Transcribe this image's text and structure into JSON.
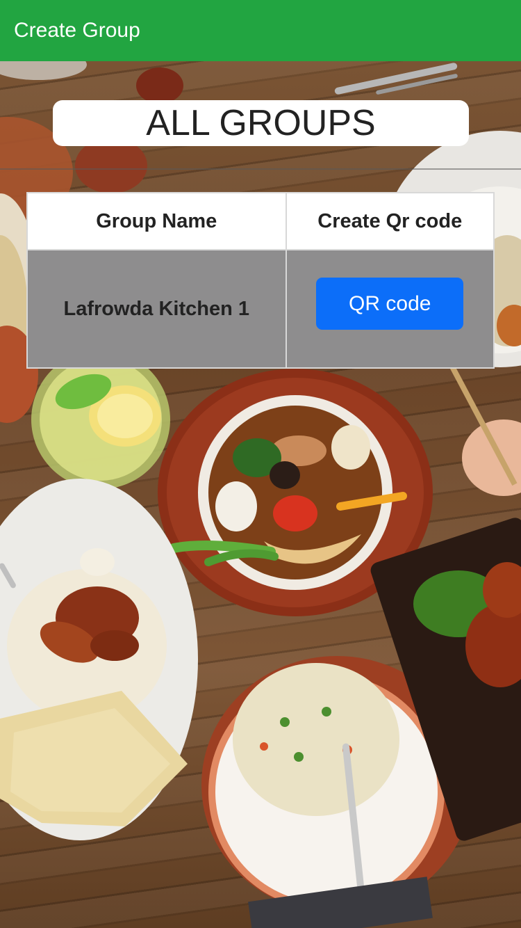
{
  "app_bar": {
    "title": "Create Group"
  },
  "page": {
    "heading": "ALL GROUPS"
  },
  "groups_table": {
    "columns": [
      "Group Name",
      "Create Qr code"
    ],
    "rows": [
      {
        "group_name": "Lafrowda Kitchen 1",
        "action_label": "QR code"
      }
    ]
  },
  "colors": {
    "app_bar": "#22a541",
    "row_background": "#8e8d8e",
    "qr_button": "#0c6ef9"
  },
  "icons": {
    "background": "food-photo-background"
  }
}
